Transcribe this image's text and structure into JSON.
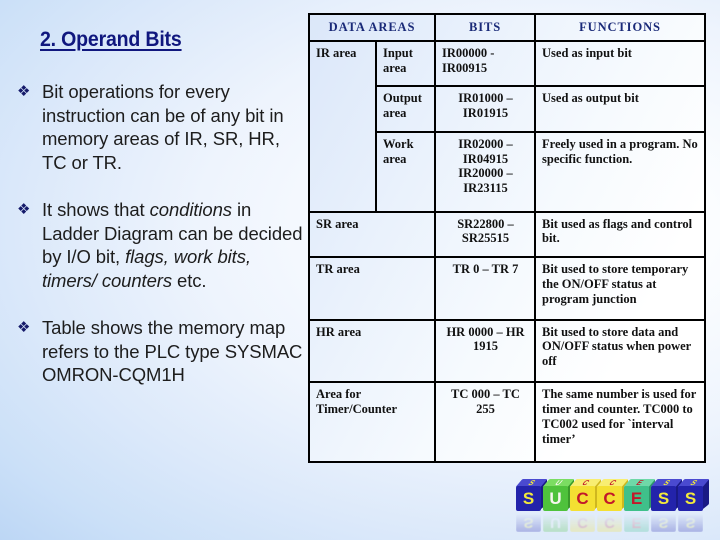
{
  "slide": {
    "title": "2. Operand Bits",
    "bullet_glyph": "❖",
    "bullets": [
      {
        "id": "bullet-operand-bits",
        "parts": [
          {
            "text": "Bit operations for every instruction can be of any bit in memory areas of  IR, SR, HR, TC or TR.",
            "italic": false
          }
        ]
      },
      {
        "id": "bullet-conditions",
        "parts": [
          {
            "text": "It shows that ",
            "italic": false
          },
          {
            "text": "conditions",
            "italic": true
          },
          {
            "text": " in Ladder Diagram can be decided by I/O bit,  ",
            "italic": false
          },
          {
            "text": "flags, work bits, timers/ counters",
            "italic": true
          },
          {
            "text": " etc.",
            "italic": false
          }
        ]
      },
      {
        "id": "bullet-memory-map",
        "parts": [
          {
            "text": "Table shows the memory map refers to the PLC type SYSMAC OMRON-CQM1H",
            "italic": false
          }
        ]
      }
    ]
  },
  "table": {
    "headers": [
      "DATA AREAS",
      "BITS",
      "FUNCTIONS"
    ],
    "rows": [
      {
        "area": "IR area",
        "area_rowspan": 3,
        "sub": "Input area",
        "bits": "IR00000 - IR00915",
        "bits_align": "left",
        "function": "Used as input bit"
      },
      {
        "area": null,
        "sub": "Output area",
        "bits": "IR01000 – IR01915",
        "bits_align": "center",
        "function": "Used as output bit"
      },
      {
        "area": null,
        "sub": "Work area",
        "bits": "IR02000 – IR04915 IR20000 – IR23115",
        "bits_align": "center",
        "function": "Freely used in a program. No specific function."
      },
      {
        "area": "SR area",
        "area_colspan": 2,
        "sub": null,
        "bits": "SR22800 – SR25515",
        "bits_align": "center",
        "function": "Bit used as  flags and control bit."
      },
      {
        "area": "TR area",
        "area_colspan": 2,
        "sub": null,
        "bits": "TR 0 – TR 7",
        "bits_align": "center",
        "function": "Bit  used to store temporary the  ON/OFF status at  program junction"
      },
      {
        "area": "HR area",
        "area_colspan": 2,
        "sub": null,
        "bits": "HR 0000 – HR 1915",
        "bits_align": "center",
        "function": "Bit used to store data and ON/OFF status when power off"
      },
      {
        "area": "Area for Timer/Counter",
        "area_colspan": 2,
        "sub": null,
        "bits": "TC 000 – TC 255",
        "bits_align": "center",
        "function": "The same number is used for timer and counter. TC000 to TC002 used for `interval timer’"
      }
    ]
  },
  "logo": {
    "name": "success-blocks-logo",
    "cubes": [
      {
        "letter": "S",
        "cube_color": "#2323ab",
        "cube_top_color": "#4a4ad0",
        "cube_side_color": "#1a1a85",
        "letter_color": "#f2e93c"
      },
      {
        "letter": "U",
        "cube_color": "#4fc23c",
        "cube_top_color": "#7bdd62",
        "cube_side_color": "#3a9a2b",
        "letter_color": "#f7f7ef"
      },
      {
        "letter": "C",
        "cube_color": "#f4e032",
        "cube_top_color": "#f8ee72",
        "cube_side_color": "#cfb71f",
        "letter_color": "#c2182a"
      },
      {
        "letter": "C",
        "cube_color": "#f4e032",
        "cube_top_color": "#f8ee72",
        "cube_side_color": "#cfb71f",
        "letter_color": "#c2182a"
      },
      {
        "letter": "E",
        "cube_color": "#3fc08a",
        "cube_top_color": "#6fd8a8",
        "cube_side_color": "#2e9668",
        "letter_color": "#c2182a"
      },
      {
        "letter": "S",
        "cube_color": "#2323ab",
        "cube_top_color": "#4a4ad0",
        "cube_side_color": "#1a1a85",
        "letter_color": "#f2e93c"
      },
      {
        "letter": "S",
        "cube_color": "#2323ab",
        "cube_top_color": "#4a4ad0",
        "cube_side_color": "#1a1a85",
        "letter_color": "#f2e93c"
      }
    ]
  },
  "colors": {
    "background_light": "#ffffff",
    "background_blue": "#b0cff3",
    "title_navy": "#10177e",
    "header_navy": "#1a2a78",
    "table_border": "#000000"
  }
}
